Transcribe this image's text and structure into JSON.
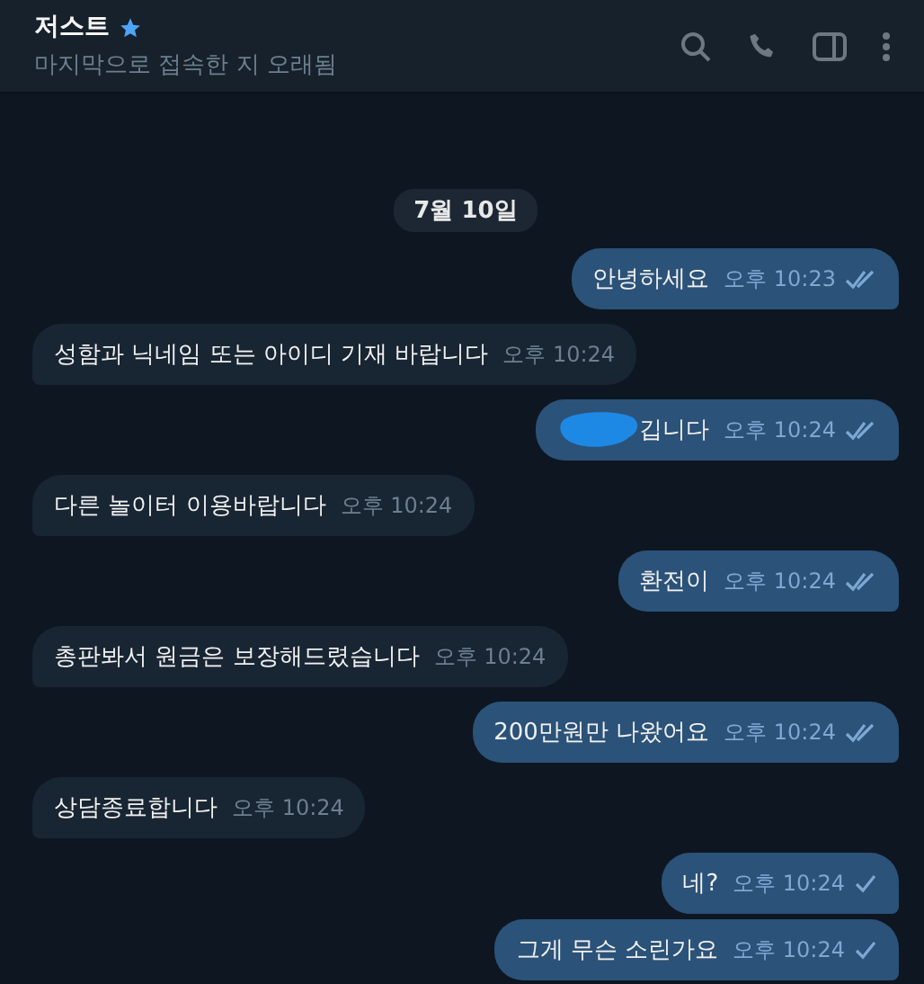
{
  "header": {
    "title": "저스트",
    "verified": true,
    "status": "마지막으로 접속한 지 오래됨"
  },
  "date": "7월 10일",
  "messages": [
    {
      "kind": "outgoing",
      "text": "안녕하세요",
      "time": "오후 10:23",
      "read": true,
      "redacted": false
    },
    {
      "kind": "incoming",
      "text": "성함과 닉네임 또는 아이디 기재 바랍니다",
      "time": "오후 10:24"
    },
    {
      "kind": "outgoing",
      "text": "깁니다",
      "time": "오후 10:24",
      "read": true,
      "redacted": true
    },
    {
      "kind": "incoming",
      "text": "다른 놀이터 이용바랍니다",
      "time": "오후 10:24"
    },
    {
      "kind": "outgoing",
      "text": "환전이",
      "time": "오후 10:24",
      "read": true,
      "redacted": false
    },
    {
      "kind": "incoming",
      "text": "총판봐서 원금은 보장해드렸습니다",
      "time": "오후 10:24"
    },
    {
      "kind": "outgoing",
      "text": "200만원만 나왔어요",
      "time": "오후 10:24",
      "read": true,
      "redacted": false
    },
    {
      "kind": "incoming",
      "text": "상담종료합니다",
      "time": "오후 10:24"
    },
    {
      "kind": "outgoing",
      "text": "네?",
      "time": "오후 10:24",
      "read": false,
      "redacted": false
    },
    {
      "kind": "outgoing",
      "text": "그게 무슨 소린가요",
      "time": "오후 10:24",
      "read": false,
      "redacted": false
    }
  ]
}
